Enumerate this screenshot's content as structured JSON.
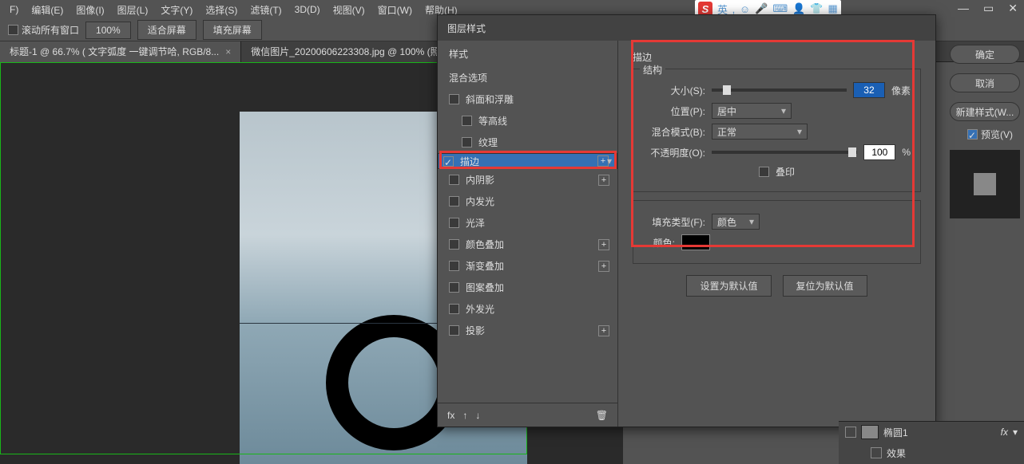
{
  "menu": {
    "items": [
      "F)",
      "编辑(E)",
      "图像(I)",
      "图层(L)",
      "文字(Y)",
      "选择(S)",
      "滤镜(T)",
      "3D(D)",
      "视图(V)",
      "窗口(W)",
      "帮助(H)"
    ]
  },
  "ime": {
    "logo": "S",
    "lang": "英"
  },
  "toolbar": {
    "scroll_all": "滚动所有窗口",
    "zoom": "100%",
    "fit": "适合屏幕",
    "fill": "填充屏幕"
  },
  "tabs": [
    {
      "label": "标题-1 @ 66.7% ( 文字弧度 一键调节哈, RGB/8...",
      "active": true
    },
    {
      "label": "微信图片_20200606223308.jpg @ 100% (照...",
      "active": false
    }
  ],
  "dialog": {
    "title": "图层样式",
    "styles_header": "样式",
    "blend": "混合选项",
    "items": [
      {
        "label": "斜面和浮雕",
        "checked": false,
        "plus": false
      },
      {
        "label": "等高线",
        "checked": false,
        "plus": false,
        "indent": true
      },
      {
        "label": "纹理",
        "checked": false,
        "plus": false,
        "indent": true
      },
      {
        "label": "描边",
        "checked": true,
        "plus": true,
        "selected": true
      },
      {
        "label": "内阴影",
        "checked": false,
        "plus": true
      },
      {
        "label": "内发光",
        "checked": false,
        "plus": false
      },
      {
        "label": "光泽",
        "checked": false,
        "plus": false
      },
      {
        "label": "颜色叠加",
        "checked": false,
        "plus": true
      },
      {
        "label": "渐变叠加",
        "checked": false,
        "plus": true
      },
      {
        "label": "图案叠加",
        "checked": false,
        "plus": false
      },
      {
        "label": "外发光",
        "checked": false,
        "plus": false
      },
      {
        "label": "投影",
        "checked": false,
        "plus": true
      }
    ],
    "fx": "fx",
    "panel_title": "描边",
    "group_struct": "结构",
    "size_label": "大小(S):",
    "size_value": "32",
    "size_unit": "像素",
    "pos_label": "位置(P):",
    "pos_value": "居中",
    "blend_label": "混合模式(B):",
    "blend_value": "正常",
    "opacity_label": "不透明度(O):",
    "opacity_value": "100",
    "opacity_unit": "%",
    "overprint": "叠印",
    "fill_label": "填充类型(F):",
    "fill_value": "颜色",
    "color_label": "颜色:",
    "set_default": "设置为默认值",
    "reset_default": "复位为默认值",
    "ok": "确定",
    "cancel": "取消",
    "new_style": "新建样式(W...",
    "preview": "预览(V)"
  },
  "layers": {
    "name": "椭圆1",
    "fx": "fx",
    "effects": "效果"
  }
}
